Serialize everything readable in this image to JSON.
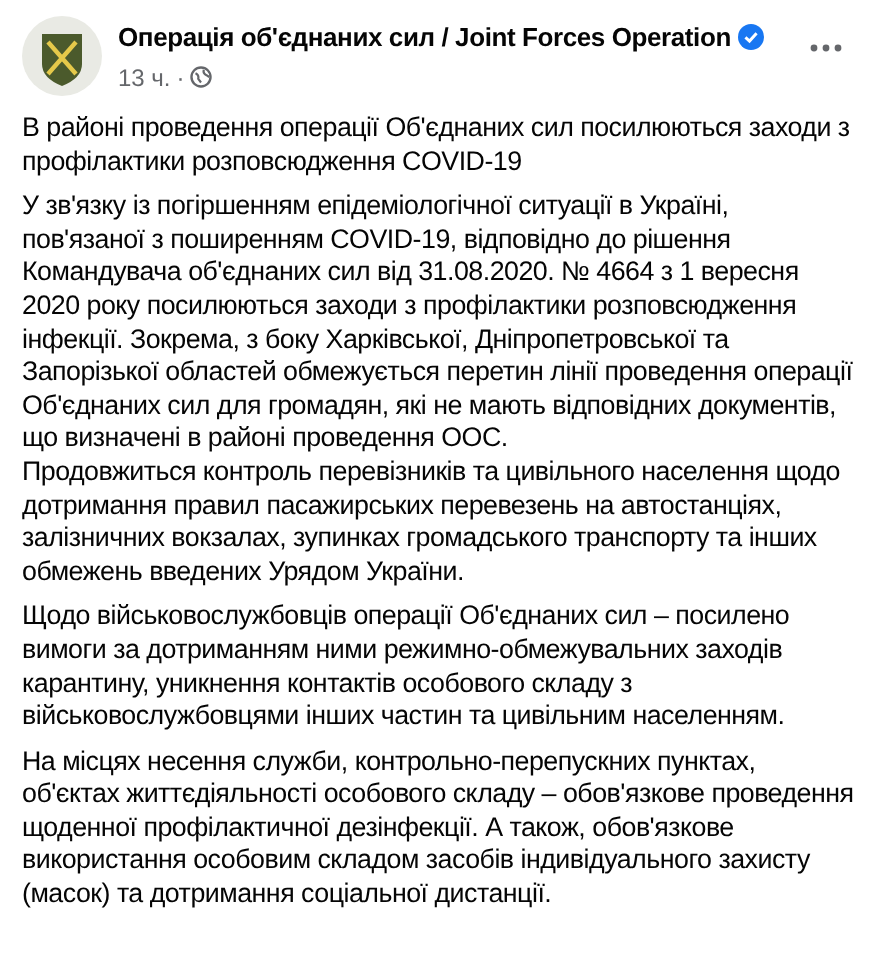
{
  "post": {
    "author": "Операція об'єднаних сил / Joint Forces Operation",
    "verified": true,
    "time": "13 ч.",
    "separator": "·",
    "paragraphs": [
      "В районі проведення операції Об'єднаних сил посилюються заходи з профілактики розповсюдження COVID-19",
      "У зв'язку із погіршенням епідеміологічної ситуації в Україні, пов'язаної з поширенням COVID-19, відповідно до рішення Командувача об'єднаних сил від 31.08.2020. № 4664 з 1 вересня 2020 року посилюються заходи з профілактики розповсюдження інфекції. Зокрема, з боку Харківської, Дніпропетровської та Запорізької областей обмежується перетин лінії проведення операції Об'єднаних сил для громадян, які не мають відповідних документів, що визначені в районі проведення ООС.\nПродовжиться контроль перевізників та цивільного населення щодо дотримання правил пасажирських перевезень на автостанціях, залізничних вокзалах, зупинках громадського транспорту та інших обмежень введених Урядом України.",
      "Щодо військовослужбовців операції Об'єднаних сил – посилено вимоги за дотриманням ними режимно-обмежувальних заходів карантину, уникнення контактів особового складу з військовослужбовцями інших частин та цивільним населенням.",
      "На місцях несення служби, контрольно-перепускних пунктах, об'єктах життєдіяльності особового складу – обов'язкове проведення щоденної профілактичної дезінфекції. А також, обов'язкове використання особовим складом засобів індивідуального захисту (масок) та дотримання соціальної дистанції."
    ]
  }
}
